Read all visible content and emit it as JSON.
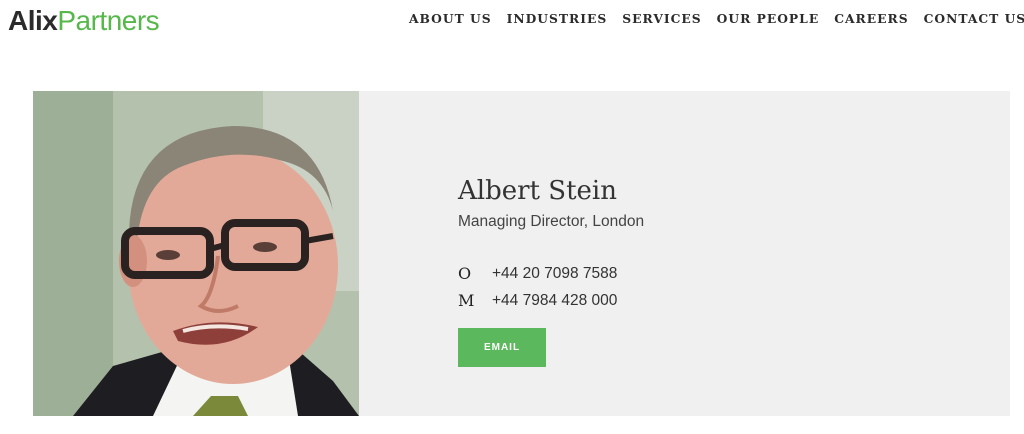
{
  "logo": {
    "part1": "Alix",
    "part2": "Partners"
  },
  "nav": [
    "ABOUT US",
    "INDUSTRIES",
    "SERVICES",
    "OUR PEOPLE",
    "CAREERS",
    "CONTACT US"
  ],
  "profile": {
    "name": "Albert Stein",
    "title": "Managing Director, London",
    "phones": [
      {
        "label": "O",
        "number": "+44 20 7098 7588"
      },
      {
        "label": "M",
        "number": "+44 7984 428 000"
      }
    ],
    "email_label": "EMAIL"
  },
  "colors": {
    "brand_green": "#56b74b",
    "button_green": "#5cb85c",
    "card_bg": "#f0f0f0"
  }
}
